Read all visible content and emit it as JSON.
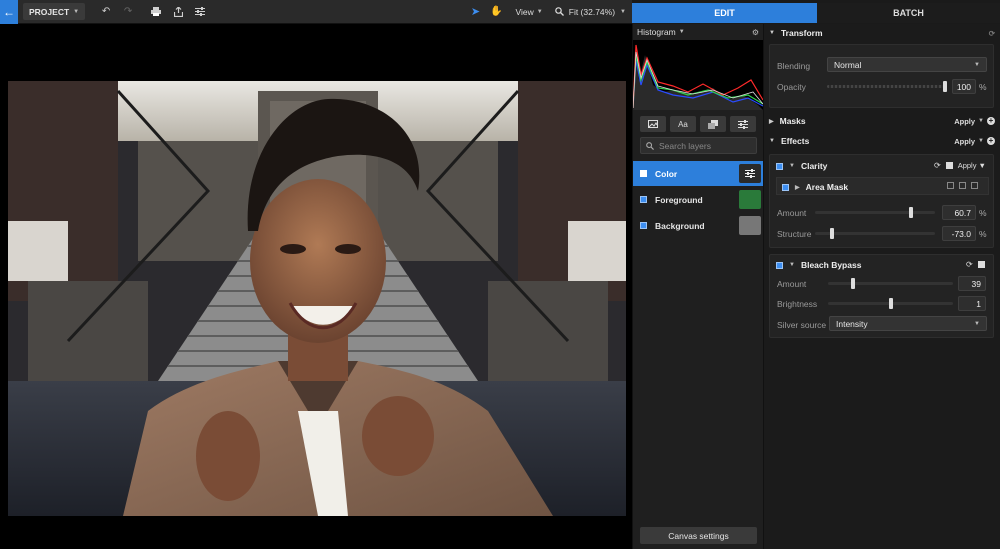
{
  "toolbar": {
    "project_label": "PROJECT",
    "view_label": "View",
    "zoom_label": "Fit (32.74%)"
  },
  "tabs": {
    "edit": "EDIT",
    "batch": "BATCH"
  },
  "histogram": {
    "label": "Histogram"
  },
  "layer_tools": {
    "text_tool": "Aa"
  },
  "search": {
    "placeholder": "Search layers"
  },
  "layers": [
    {
      "name": "Color",
      "selected": true
    },
    {
      "name": "Foreground",
      "selected": false
    },
    {
      "name": "Background",
      "selected": false
    }
  ],
  "canvas_settings_label": "Canvas settings",
  "transform": {
    "title": "Transform",
    "blending_label": "Blending",
    "blending_value": "Normal",
    "opacity_label": "Opacity",
    "opacity_value": "100",
    "opacity_unit": "%",
    "opacity_level": 1.0
  },
  "masks": {
    "title": "Masks",
    "apply_label": "Apply"
  },
  "effects": {
    "title": "Effects",
    "apply_label": "Apply"
  },
  "clarity": {
    "title": "Clarity",
    "apply_label": "Apply",
    "area_mask_label": "Area Mask",
    "amount_label": "Amount",
    "amount_value": "60.7",
    "amount_unit": "%",
    "amount_level": 0.8,
    "structure_label": "Structure",
    "structure_value": "-73.0",
    "structure_unit": "%",
    "structure_level": 0.14
  },
  "bleach_bypass": {
    "title": "Bleach Bypass",
    "amount_label": "Amount",
    "amount_value": "39",
    "amount_level": 0.2,
    "brightness_label": "Brightness",
    "brightness_value": "1",
    "brightness_level": 0.5,
    "silver_source_label": "Silver source",
    "silver_source_value": "Intensity"
  },
  "colors": {
    "accent": "#2d7fdb",
    "panel": "#1b1b1b"
  }
}
